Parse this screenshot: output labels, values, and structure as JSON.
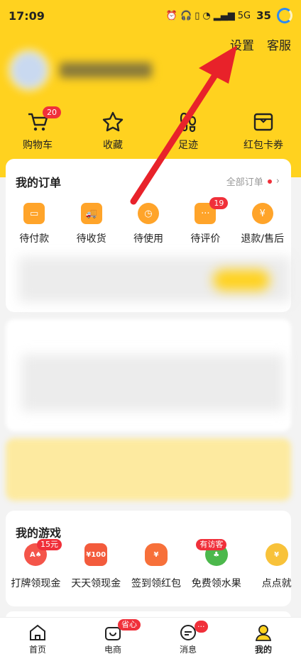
{
  "status_bar": {
    "time": "17:09",
    "battery": "35",
    "signal_text": "5G"
  },
  "header": {
    "settings_label": "设置",
    "service_label": "客服"
  },
  "quick_actions": [
    {
      "label": "购物车",
      "icon": "cart-icon",
      "badge": "20"
    },
    {
      "label": "收藏",
      "icon": "star-icon"
    },
    {
      "label": "足迹",
      "icon": "footprint-icon"
    },
    {
      "label": "红包卡券",
      "icon": "wallet-icon"
    }
  ],
  "orders": {
    "title": "我的订单",
    "all_link": "全部订单",
    "items": [
      {
        "label": "待付款",
        "icon": "wallet-icon"
      },
      {
        "label": "待收货",
        "icon": "truck-icon"
      },
      {
        "label": "待使用",
        "icon": "clock-icon"
      },
      {
        "label": "待评价",
        "icon": "comment-icon",
        "badge": "19"
      },
      {
        "label": "退款/售后",
        "icon": "refund-icon"
      }
    ]
  },
  "games": {
    "title": "我的游戏",
    "items": [
      {
        "label": "打牌领现金",
        "icon": "cards-icon",
        "tag": "15元"
      },
      {
        "label": "天天领现金",
        "icon": "money-icon",
        "icon_text": "¥100"
      },
      {
        "label": "签到领红包",
        "icon": "redpacket-icon"
      },
      {
        "label": "免费领水果",
        "icon": "tree-icon",
        "tag": "有访客"
      },
      {
        "label": "点点就",
        "icon": "coin-icon"
      }
    ]
  },
  "bottom_nav": [
    {
      "label": "首页",
      "icon": "home-icon"
    },
    {
      "label": "电商",
      "icon": "shop-icon",
      "tag": "省心"
    },
    {
      "label": "消息",
      "icon": "message-icon"
    },
    {
      "label": "我的",
      "icon": "profile-icon"
    }
  ],
  "colors": {
    "brand_yellow": "#ffd21f",
    "badge_red": "#f0303a",
    "order_orange": "#ffa42a",
    "arrow_red": "#e8222a"
  }
}
